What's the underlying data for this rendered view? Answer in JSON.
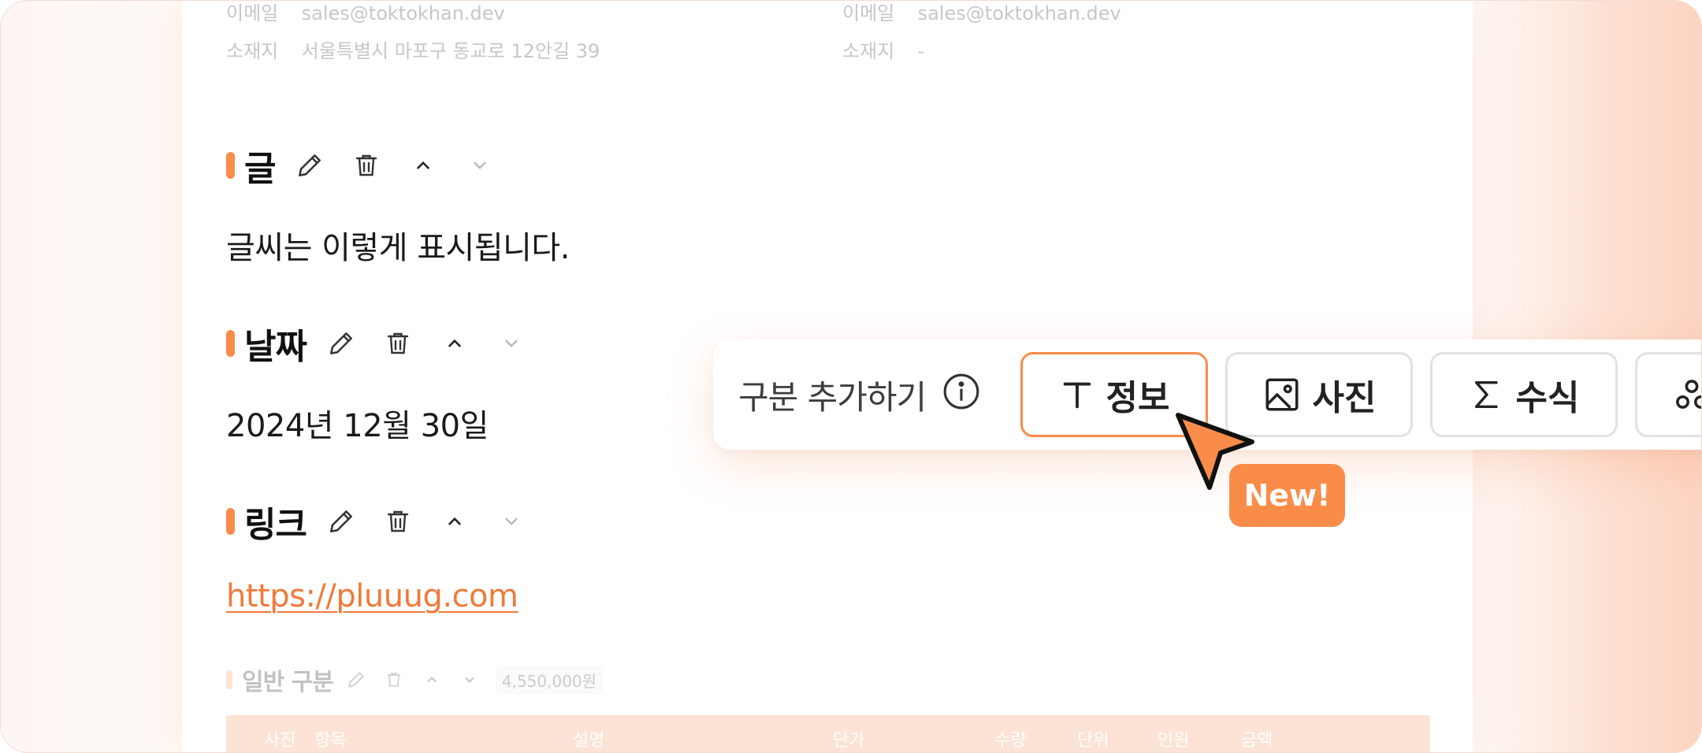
{
  "company_info": {
    "left": {
      "email_label": "이메일",
      "email": "sales@toktokhan.dev",
      "address_label": "소재지",
      "address": "서울특별시 마포구 동교로 12안길 39"
    },
    "right": {
      "email_label": "이메일",
      "email": "sales@toktokhan.dev",
      "address_label": "소재지",
      "address": "-"
    }
  },
  "sections": [
    {
      "title": "글",
      "content": "글씨는 이렇게 표시됩니다."
    },
    {
      "title": "날짜",
      "content": "2024년 12월 30일"
    },
    {
      "title": "링크",
      "content": "https://pluuug.com"
    }
  ],
  "general_section": {
    "title": "일반 구분",
    "amount": "4,550,000원"
  },
  "table": {
    "headers": [
      "사진",
      "항목",
      "설명",
      "단가",
      "수량",
      "단위",
      "인원",
      "금액"
    ]
  },
  "toolbar": {
    "label": "구분 추가하기",
    "buttons": [
      {
        "label": "정보",
        "icon": "text-t-icon",
        "active": true
      },
      {
        "label": "사진",
        "icon": "image-icon",
        "active": false
      },
      {
        "label": "수식",
        "icon": "sigma-icon",
        "active": false
      }
    ],
    "new_badge": "New!"
  },
  "colors": {
    "accent": "#fa8c4a",
    "link": "#f07a3a",
    "border": "#dfe2e6"
  }
}
